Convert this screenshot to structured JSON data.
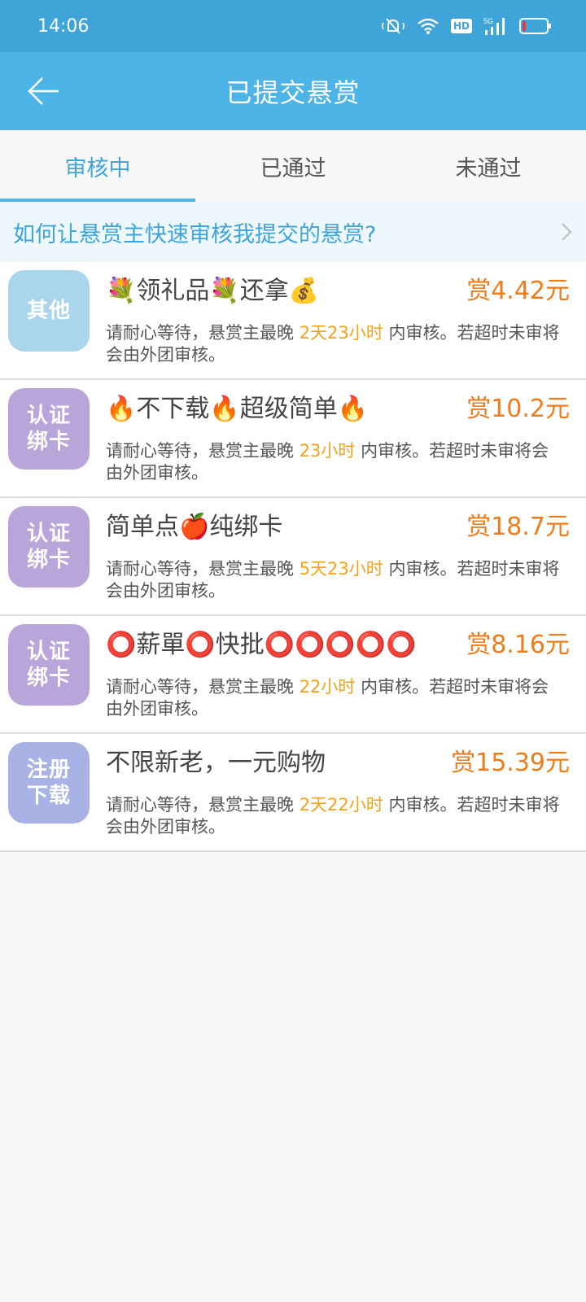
{
  "status_bar": {
    "time": "14:06",
    "hd": "HD",
    "network": "5G"
  },
  "header": {
    "title": "已提交悬赏"
  },
  "tabs": [
    {
      "label": "审核中",
      "active": true
    },
    {
      "label": "已通过",
      "active": false
    },
    {
      "label": "未通过",
      "active": false
    }
  ],
  "help_banner": {
    "text": "如何让悬赏主快速审核我提交的悬赏?"
  },
  "desc_prefix": "请耐心等待，悬赏主最晚",
  "desc_suffix": "内审核。若超时未审将会由外团审核。",
  "items": [
    {
      "tag": "其他",
      "tag_color": "#a9d6ec",
      "title": "💐领礼品💐还拿💰",
      "reward": "赏4.42元",
      "deadline": "2天23小时"
    },
    {
      "tag": "认证绑卡",
      "tag_color": "#b9a5d9",
      "title": "🔥不下载🔥超级简单🔥",
      "reward": "赏10.2元",
      "deadline": "23小时"
    },
    {
      "tag": "认证绑卡",
      "tag_color": "#b9a5d9",
      "title": "简单点🍎纯绑卡",
      "reward": "赏18.7元",
      "deadline": "5天23小时"
    },
    {
      "tag": "认证绑卡",
      "tag_color": "#b9a5d9",
      "title": "⭕薪單⭕快批⭕⭕⭕⭕⭕",
      "reward": "赏8.16元",
      "deadline": "22小时"
    },
    {
      "tag": "注册下载",
      "tag_color": "#a8b2e4",
      "title": "不限新老，一元购物",
      "reward": "赏15.39元",
      "deadline": "2天22小时"
    }
  ]
}
